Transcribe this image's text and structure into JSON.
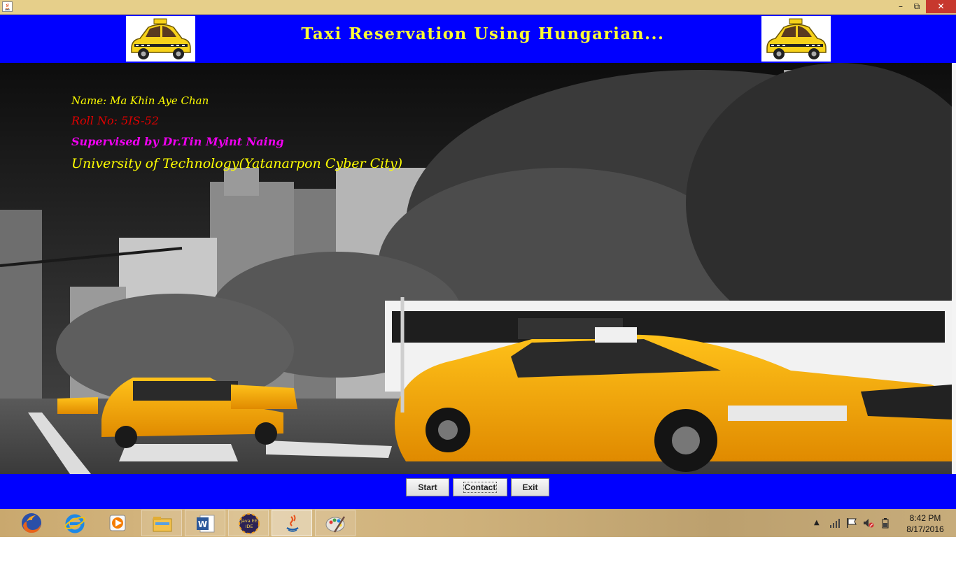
{
  "window": {
    "app_icon": "java-icon",
    "minimize_label": "–",
    "maximize_label": "⧉",
    "close_label": "✕"
  },
  "header": {
    "title": "Taxi Reservation Using Hungarian...",
    "logo_icon": "taxi-logo-icon",
    "background": "#0000ff",
    "title_color": "#ffff33"
  },
  "info": {
    "name": "Name: Ma Khin Aye Chan",
    "roll": "Roll No: 5IS-52",
    "supervisor": "Supervised by Dr.Tin Myint Naing",
    "university": "University of Technology(Yatanarpon Cyber City)"
  },
  "buttons": {
    "start": "Start",
    "contact": "Contact",
    "exit": "Exit"
  },
  "taskbar": {
    "apps": [
      {
        "icon": "firefox-icon"
      },
      {
        "icon": "internet-explorer-icon"
      },
      {
        "icon": "media-player-icon"
      },
      {
        "icon": "file-explorer-icon"
      },
      {
        "icon": "word-icon",
        "label": "W"
      },
      {
        "icon": "java-ee-ide-icon",
        "label": "Java EE IDE"
      },
      {
        "icon": "java-icon"
      },
      {
        "icon": "paint-icon"
      }
    ],
    "tray_icons": [
      "show-hidden-icons-arrow",
      "network-icon",
      "flag-icon",
      "volume-muted-icon",
      "power-icon"
    ],
    "time": "8:42 PM",
    "date": "8/17/2016"
  }
}
